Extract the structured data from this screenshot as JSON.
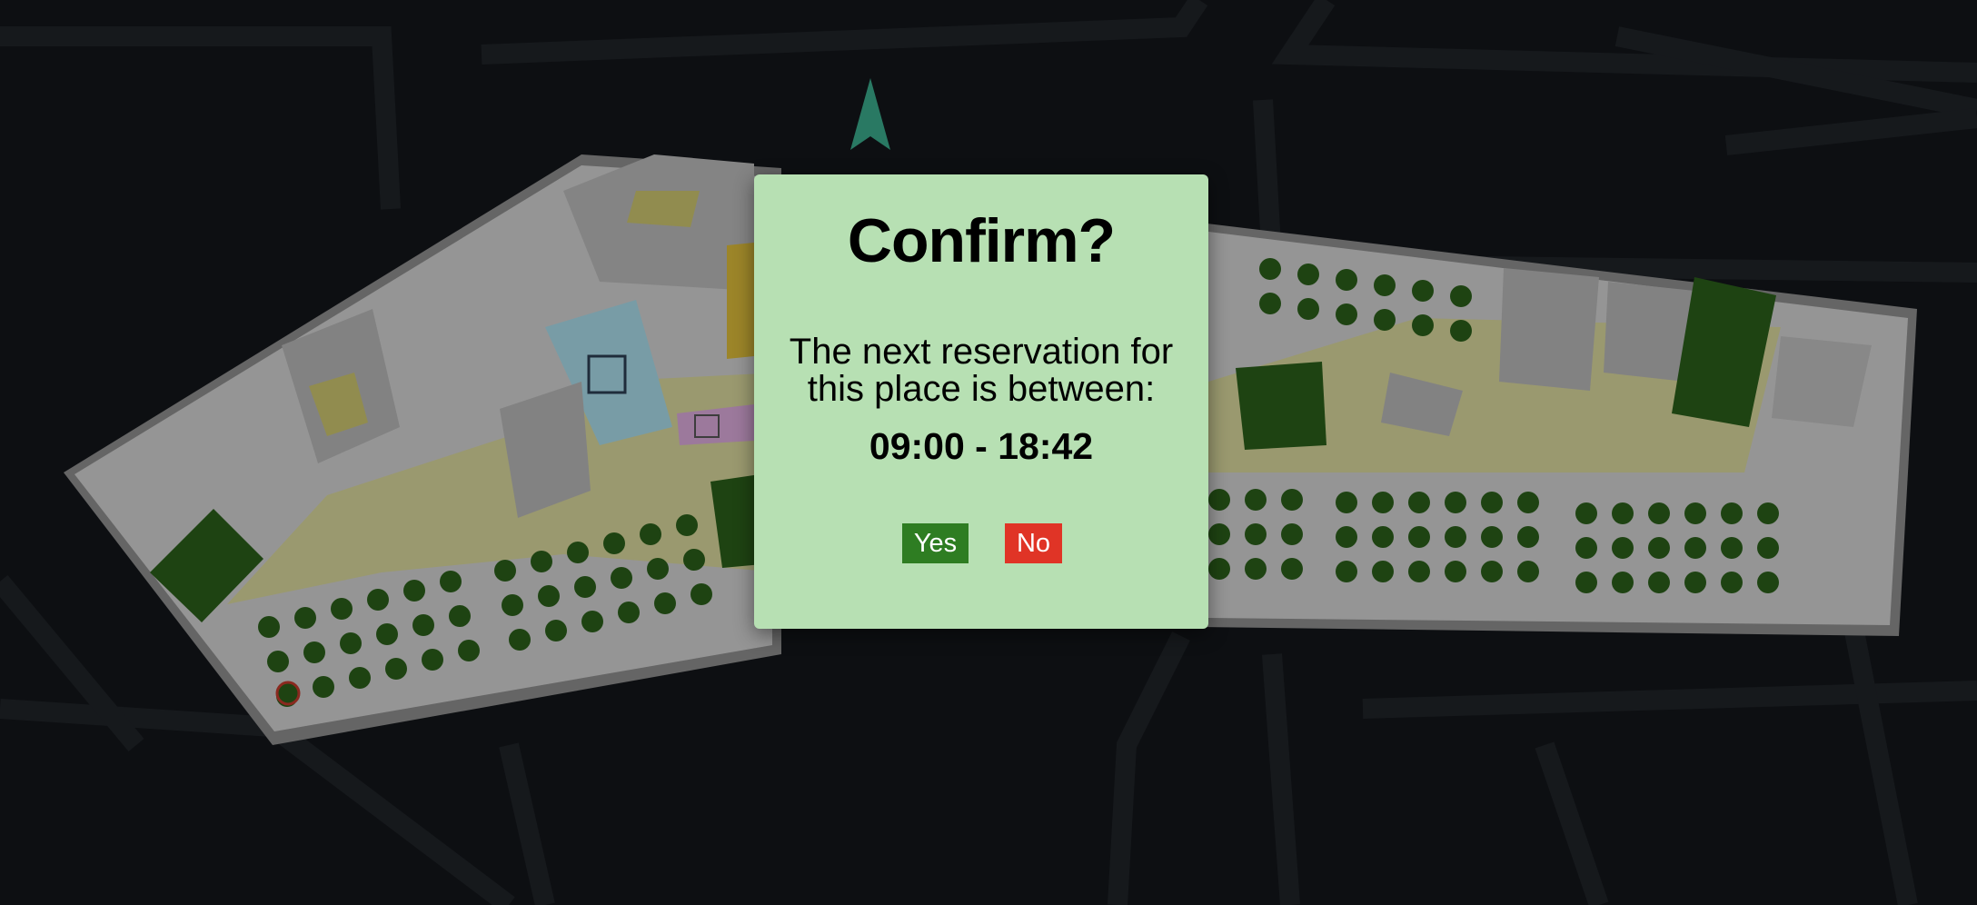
{
  "dialog": {
    "title": "Confirm?",
    "message": "The next reservation for this place is between:",
    "time_range": "09:00 - 18:42",
    "yes_label": "Yes",
    "no_label": "No"
  },
  "colors": {
    "background": "#13161a",
    "dialog_background": "#b7e0b3",
    "yes_button": "#2e7d22",
    "no_button": "#e03426",
    "seat_available": "#2a5e1a",
    "seat_selected_outline": "#c0392b",
    "compass": "#3aa88a",
    "corridor": "#d6d49a",
    "meeting_room": "#a7d8e6"
  },
  "map": {
    "compass_icon": "north-arrow-icon",
    "room_icons": [
      "elevator-icon",
      "restroom-icon"
    ]
  }
}
